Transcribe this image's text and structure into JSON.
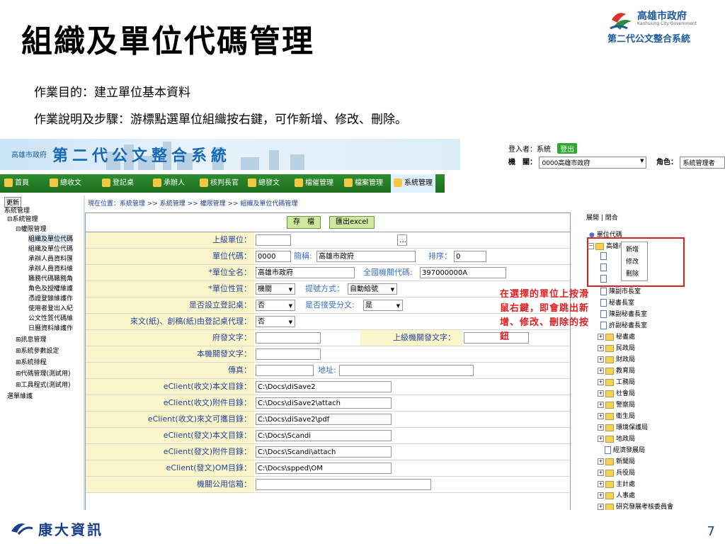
{
  "slide": {
    "title": "組織及單位代碼管理",
    "purpose": "作業目的：建立單位基本資料",
    "steps": "作業說明及步驟：游標點選單位組織按右鍵，可作新增、修改、刪除。",
    "page_number": "7",
    "footer_brand": "康大資訊"
  },
  "brand": {
    "city": "高雄市政府",
    "city_en": "Kaohsiung City Government",
    "system": "第二代公文整合系統"
  },
  "app": {
    "small_logo": "高雄市政府",
    "title": "第二代公文整合系統",
    "user_label": "登入者：系統",
    "logout": "登出",
    "org_label": "機　關：",
    "org_value": "0000高雄市政府",
    "role_label": "角色：",
    "role_value": "系統管理者"
  },
  "menu": [
    "首頁",
    "總收文",
    "登記桌",
    "承辦人",
    "核判長官",
    "總發文",
    "檔催管理",
    "檔案管理",
    "系統管理"
  ],
  "leftnav": {
    "update": "更新",
    "items": [
      "系統管理",
      "系統管理",
      "權限管理",
      "組織及單位代碼",
      "組織及單位代碼",
      "承辦人員資料匯",
      "承辦人員資料維",
      "職務代碼職務角",
      "角色及授權維護",
      "憑證登錄維護作",
      "使用者登出入紀",
      "公文性質代碼維",
      "日曆資料維護作",
      "訊息管理",
      "系統參數設定",
      "系統排程",
      "代碼管理(測試用)",
      "工具程式(測試用)",
      "選單維護"
    ]
  },
  "breadcrumb": "現在位置：系統管理 >> 系統管理 >> 權限管理 >> 組織及單位代碼管理",
  "toolbar": {
    "save": "存　檔",
    "export": "匯出excel"
  },
  "form": {
    "parent_unit": "上級單位：",
    "unit_code": "單位代碼：",
    "unit_code_value": "0000",
    "short_name_label": "簡稱:",
    "short_name_value": "高雄市政府",
    "order_label": "排序：",
    "order_value": "0",
    "full_name": "*單位全名：",
    "full_name_value": "高雄市政府",
    "national_code_label": "全國機關代碼:",
    "national_code_value": "397000000A",
    "unit_type": "*單位性質：",
    "unit_type_value": "機關",
    "number_mode_label": "提號方式：",
    "number_mode_value": "自動給號",
    "is_desk": "是否設立登記桌：",
    "is_desk_value": "否",
    "accept_dispatch_label": "是否接受分文:",
    "accept_dispatch_value": "是",
    "agent_desk": "來文(紙)、創稿(紙)由登記桌代理：",
    "agent_desk_value": "否",
    "gov_text": "府發文字：",
    "parent_text_label": "上級機關發文字：",
    "org_text": "本機關發文字：",
    "fax": "傳真：",
    "address_label": "地址:",
    "recv_body": "eClient(收文)本文目錄：",
    "recv_body_value": "C:\\Docs\\diSave2",
    "recv_attach": "eClient(收文)附件目錄：",
    "recv_attach_value": "C:\\Docs\\diSave2\\attach",
    "recv_scan": "eClient(收文)來文可攜目錄：",
    "recv_scan_value": "C:\\Docs\\diSave2\\pdf",
    "send_body": "eClient(發文)本文目錄：",
    "send_body_value": "C:\\Docs\\Scandi",
    "send_attach": "eClient(發文)附件目錄：",
    "send_attach_value": "C:\\Docs\\Scandi\\attach",
    "send_om": "eClient(發文)OM目錄：",
    "send_om_value": "C:\\Docs\\spped\\OM",
    "public_mail": "機關公用信箱："
  },
  "tree": {
    "controls": "展開 | 閉合",
    "root": "單位代碼",
    "top": "高雄市",
    "context_menu": [
      "新增",
      "修改",
      "刪除"
    ],
    "items": [
      "陳副市長室",
      "秘書長室",
      "陳副秘書長室",
      "許副秘書長室",
      "秘書處",
      "民政局",
      "財政局",
      "教育局",
      "工務局",
      "社會局",
      "警察局",
      "衛生局",
      "環境保護局",
      "地政局",
      "經濟發展局",
      "新聞局",
      "兵役局",
      "主計處",
      "人事處",
      "研究發展考核委員會"
    ]
  },
  "annotation": "在選擇的單位上按滑鼠右鍵，即會跳出新增、修改、刪除的按鈕"
}
